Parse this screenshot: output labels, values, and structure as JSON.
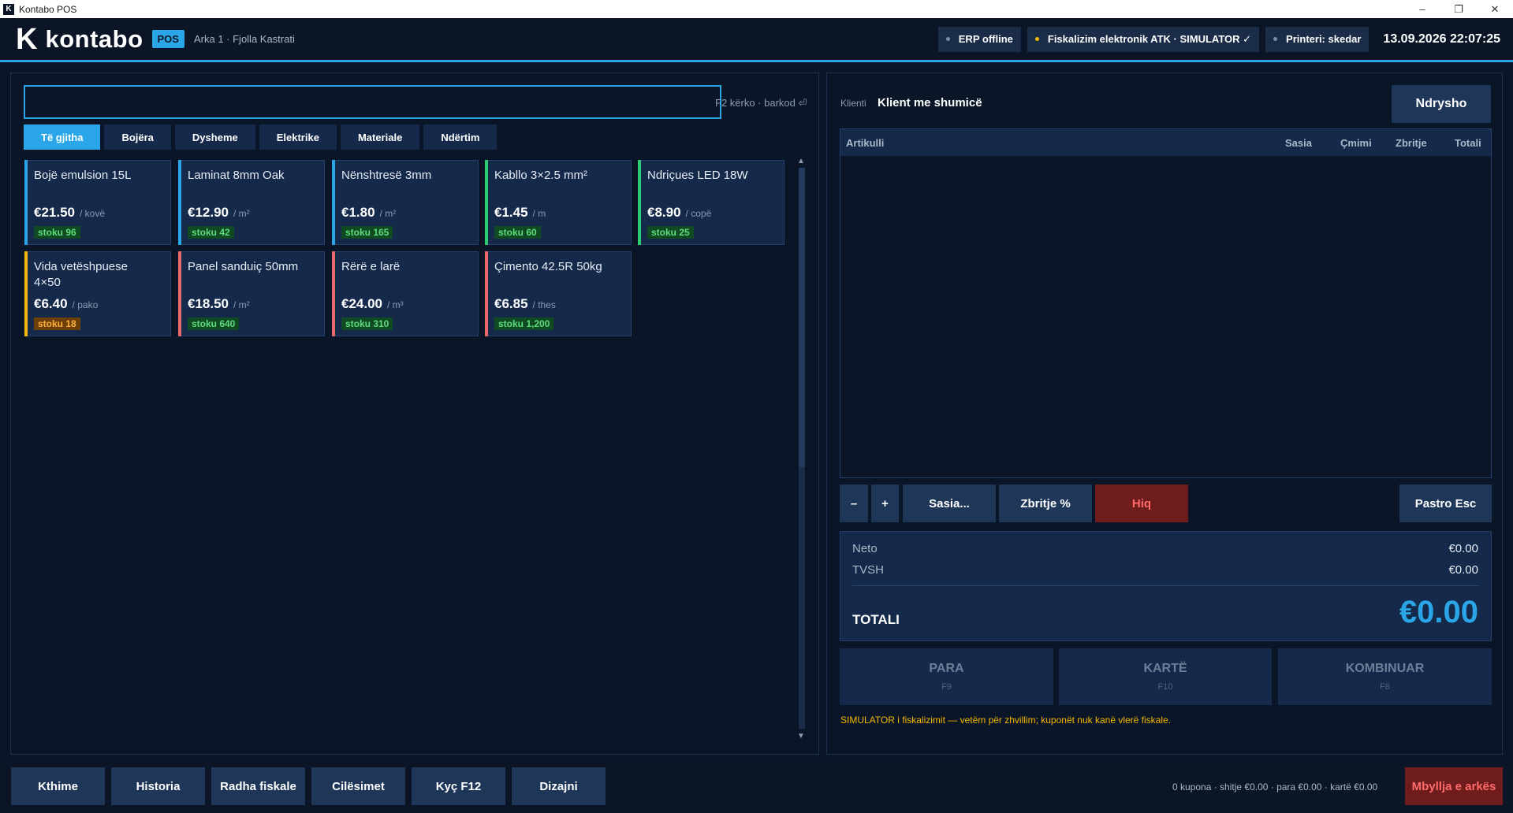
{
  "window": {
    "icon_letter": "K",
    "title": "Kontabo POS",
    "minimize": "–",
    "maximize": "❐",
    "close": "✕"
  },
  "header": {
    "logo_mark": "K",
    "logo_text": "kontabo",
    "badge": "POS",
    "register": "Arka 1 · Fjolla Kastrati",
    "statuses": [
      {
        "label": "ERP offline",
        "dot": "gray"
      },
      {
        "label": "Fiskalizim elektronik ATK · SIMULATOR ✓",
        "dot": "yellow"
      },
      {
        "label": "Printeri: skedar",
        "dot": "gray"
      }
    ],
    "datetime": "13.09.2026  22:07:25"
  },
  "search": {
    "value": "",
    "hint": "F2 kërko · barkod ⏎"
  },
  "categories": [
    {
      "label": "Të gjitha",
      "active": true
    },
    {
      "label": "Bojëra",
      "active": false
    },
    {
      "label": "Dysheme",
      "active": false
    },
    {
      "label": "Elektrike",
      "active": false
    },
    {
      "label": "Materiale",
      "active": false
    },
    {
      "label": "Ndërtim",
      "active": false
    }
  ],
  "products": [
    {
      "name": "Bojë emulsion 15L",
      "price": "€21.50",
      "unit": "/ kovë",
      "stock": "stoku 96",
      "stock_level": "ok",
      "accent": "#2aa6e8"
    },
    {
      "name": "Laminat 8mm Oak",
      "price": "€12.90",
      "unit": "/ m²",
      "stock": "stoku 42",
      "stock_level": "ok",
      "accent": "#2aa6e8"
    },
    {
      "name": "Nënshtresë 3mm",
      "price": "€1.80",
      "unit": "/ m²",
      "stock": "stoku 165",
      "stock_level": "ok",
      "accent": "#2aa6e8"
    },
    {
      "name": "Kabllo 3×2.5 mm²",
      "price": "€1.45",
      "unit": "/ m",
      "stock": "stoku 60",
      "stock_level": "ok",
      "accent": "#2ecc71"
    },
    {
      "name": "Ndriçues LED 18W",
      "price": "€8.90",
      "unit": "/ copë",
      "stock": "stoku 25",
      "stock_level": "ok",
      "accent": "#2ecc71"
    },
    {
      "name": "Vida vetëshpuese 4×50",
      "price": "€6.40",
      "unit": "/ pako",
      "stock": "stoku 18",
      "stock_level": "low",
      "accent": "#f5b800"
    },
    {
      "name": "Panel sanduiç 50mm",
      "price": "€18.50",
      "unit": "/ m²",
      "stock": "stoku 640",
      "stock_level": "ok",
      "accent": "#e86a6a"
    },
    {
      "name": "Rërë e larë",
      "price": "€24.00",
      "unit": "/ m³",
      "stock": "stoku 310",
      "stock_level": "ok",
      "accent": "#e86a6a"
    },
    {
      "name": "Çimento 42.5R 50kg",
      "price": "€6.85",
      "unit": "/ thes",
      "stock": "stoku 1,200",
      "stock_level": "ok",
      "accent": "#e86a6a"
    }
  ],
  "client": {
    "label": "Klienti",
    "name": "Klient me shumicë",
    "change_button": "Ndrysho"
  },
  "cart": {
    "columns": [
      "Artikulli",
      "Sasia",
      "Çmimi",
      "Zbritje",
      "Totali"
    ],
    "rows": []
  },
  "cart_actions": {
    "minus": "–",
    "plus": "+",
    "quantity": "Sasia...",
    "discount": "Zbritje %",
    "remove": "Hiq",
    "clear": "Pastro  Esc"
  },
  "totals": {
    "net_label": "Neto",
    "net_value": "€0.00",
    "vat_label": "TVSH",
    "vat_value": "€0.00",
    "total_label": "TOTALI",
    "total_value": "€0.00"
  },
  "payments": [
    {
      "label": "PARA",
      "key": "F9"
    },
    {
      "label": "KARTË",
      "key": "F10"
    },
    {
      "label": "KOMBINUAR",
      "key": "F8"
    }
  ],
  "simulator_note": "SIMULATOR i fiskalizimit — vetëm për zhvillim; kuponët nuk kanë vlerë fiskale.",
  "footer": {
    "buttons": [
      "Kthime",
      "Historia",
      "Radha fiskale",
      "Cilësimet",
      "Kyç  F12",
      "Dizajni"
    ],
    "summary": "0 kupona · shitje €0.00 · para €0.00 · kartë €0.00",
    "close_register": "Mbyllja e arkës"
  },
  "colors": {
    "accent": "#2aa6e8",
    "background": "#0a1628",
    "danger": "#6e1c1c",
    "warning": "#f5b800"
  }
}
